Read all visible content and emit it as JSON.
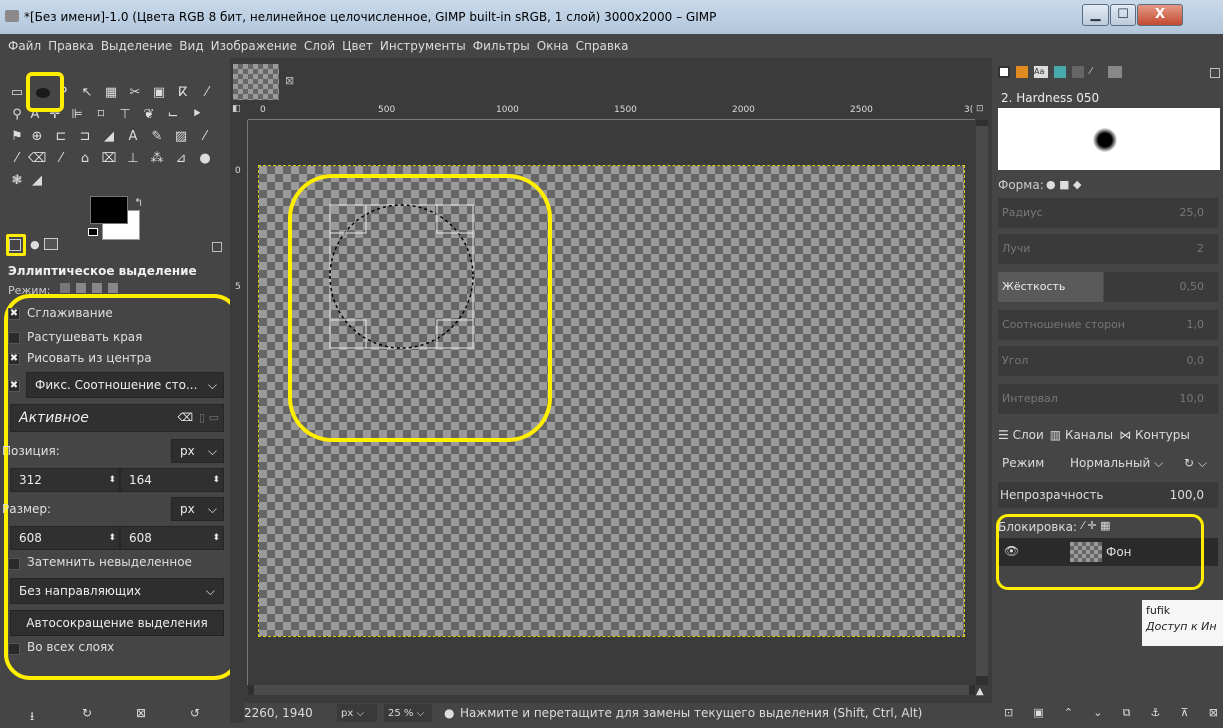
{
  "window": {
    "title": "*[Без имени]-1.0 (Цвета RGB 8 бит, нелинейное целочисленное, GIMP built-in sRGB, 1 слой) 3000x2000 – GIMP",
    "min": "▁",
    "max": "☐",
    "close": "X"
  },
  "menu": [
    "Файл",
    "Правка",
    "Выделение",
    "Вид",
    "Изображение",
    "Слой",
    "Цвет",
    "Инструменты",
    "Фильтры",
    "Окна",
    "Справка"
  ],
  "tool_options": {
    "title": "Эллиптическое выделение",
    "mode_label": "Режим:",
    "antialias": "Сглаживание",
    "feather": "Растушевать края",
    "from_center": "Рисовать из центра",
    "fixed": "Фикс. Соотношение сто...",
    "active": "Активное",
    "position_label": "Позиция:",
    "unit": "px",
    "pos_x": "312",
    "pos_y": "164",
    "size_label": "Размер:",
    "size_w": "608",
    "size_h": "608",
    "darken": "Затемнить невыделенное",
    "guides": "Без направляющих",
    "autoshrink": "Автосокращение выделения",
    "all_layers": "Во всех слоях"
  },
  "ruler": {
    "marks": [
      "0",
      "500",
      "1000",
      "1500",
      "2000",
      "2500",
      "3("
    ],
    "vmarks": [
      "0",
      "5"
    ]
  },
  "status": {
    "coords": "2260, 1940",
    "unit": "px",
    "zoom": "25 %",
    "hint": "Нажмите и перетащите для замены текущего выделения (Shift, Ctrl, Alt)"
  },
  "brushes": {
    "name": "2. Hardness 050",
    "shape_label": "Форма:",
    "sliders": [
      {
        "label": "Радиус",
        "value": "25,0"
      },
      {
        "label": "Лучи",
        "value": "2"
      },
      {
        "label": "Жёсткость",
        "value": "0,50"
      },
      {
        "label": "Соотношение сторон",
        "value": "1,0"
      },
      {
        "label": "Угол",
        "value": "0,0"
      },
      {
        "label": "Интервал",
        "value": "10,0"
      }
    ]
  },
  "layers": {
    "tabs": [
      "Слои",
      "Каналы",
      "Контуры"
    ],
    "mode_label": "Режим",
    "mode": "Нормальный",
    "opacity_label": "Непрозрачность",
    "opacity": "100,0",
    "lock_label": "Блокировка:",
    "layer": "Фон"
  },
  "tooltip": {
    "user": "fufik",
    "text": "Доступ к Ин"
  }
}
